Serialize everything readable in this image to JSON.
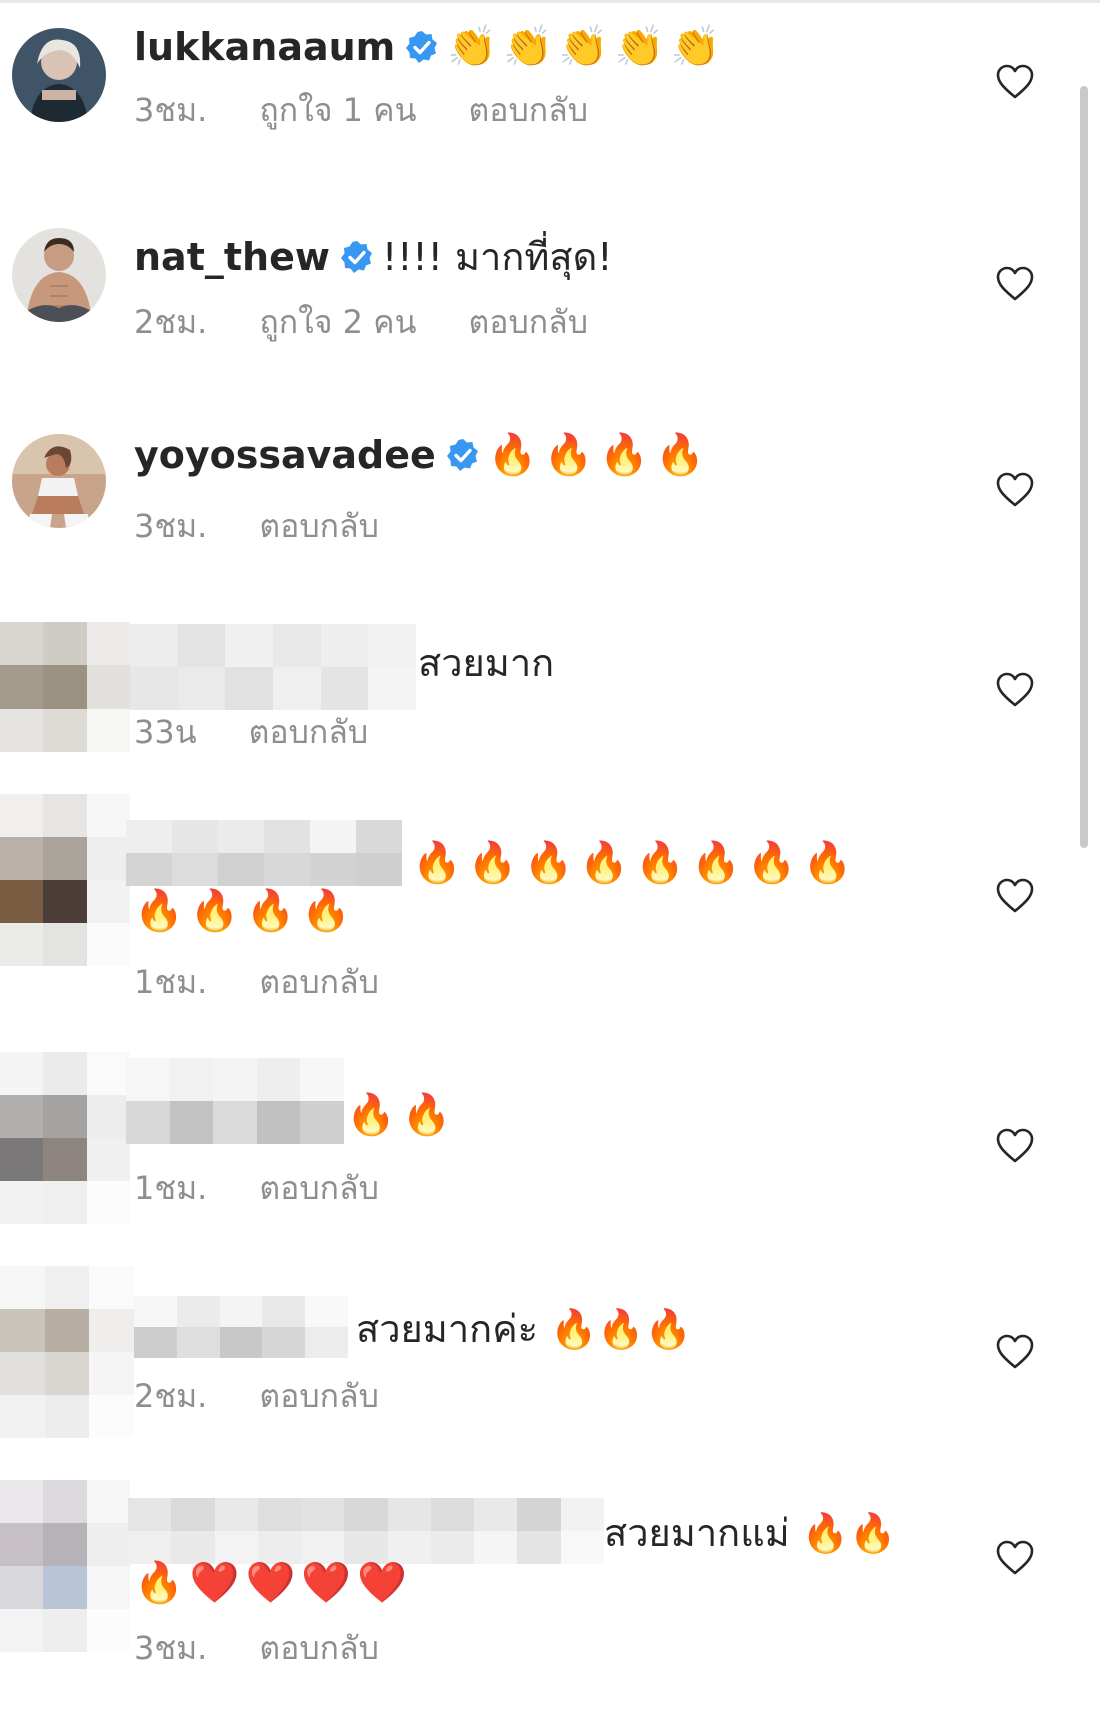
{
  "comments": [
    {
      "username": "lukkanaaum",
      "verified": true,
      "text": "👏👏👏👏👏",
      "time": "3ชม.",
      "likes": "ถูกใจ 1 คน",
      "reply": "ตอบกลับ"
    },
    {
      "username": "nat_thew",
      "verified": true,
      "text": "!!!! มากที่สุด!",
      "time": "2ชม.",
      "likes": "ถูกใจ 2 คน",
      "reply": "ตอบกลับ"
    },
    {
      "username": "yoyossavadee",
      "verified": true,
      "text": "🔥🔥🔥🔥",
      "time": "3ชม.",
      "reply": "ตอบกลับ"
    },
    {
      "text": "สวยมาก",
      "time": "33น",
      "reply": "ตอบกลับ"
    },
    {
      "text": "🔥🔥🔥🔥🔥🔥🔥🔥",
      "text2": "🔥🔥🔥🔥",
      "time": "1ชม.",
      "reply": "ตอบกลับ"
    },
    {
      "text": "🔥🔥",
      "time": "1ชม.",
      "reply": "ตอบกลับ"
    },
    {
      "text": "สวยมากค่ะ 🔥🔥🔥",
      "time": "2ชม.",
      "reply": "ตอบกลับ"
    },
    {
      "text": "สวยมากแม่ 🔥🔥",
      "text2": "🔥❤️❤️❤️❤️",
      "time": "3ชม.",
      "reply": "ตอบกลับ"
    }
  ],
  "colors": {
    "meta_text": "#8e8e8e",
    "verified_badge": "#3897f0",
    "text": "#262626"
  }
}
